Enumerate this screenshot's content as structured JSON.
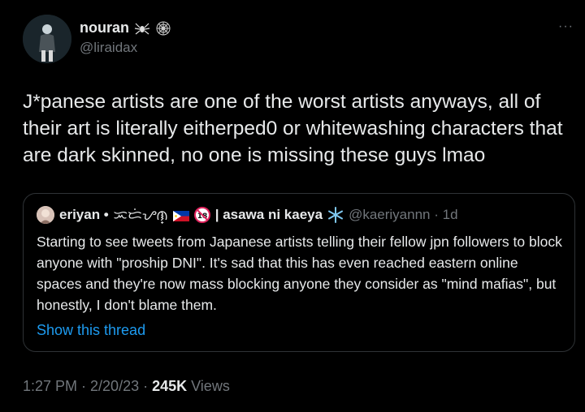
{
  "author": {
    "name": "nouran",
    "handle": "@liraidax",
    "name_icons": [
      "spider-icon",
      "spiderweb-icon"
    ]
  },
  "more_label": "···",
  "tweet": {
    "text": "J*panese artists are one of the worst artists anyways, all of their art is literally eitherped0 or whitewashing characters that are dark skinned, no one is missing these guys lmao"
  },
  "quote": {
    "name": "eriyan •",
    "script_text": "ᜁᜇᜒᜌᜈ᜔",
    "display_extra": "| asawa ni kaeya",
    "handle_time": "@kaeriyannn · 1d",
    "icons": [
      "philippines-flag-icon",
      "18-plus-icon",
      "snowflake-icon"
    ],
    "text": "Starting to see tweets from Japanese artists telling their fellow jpn followers to block anyone with \"proship DNI\". It's sad that this has even reached eastern online spaces and they're now  mass blocking anyone they consider as \"mind mafias\", but honestly, I don't blame them.",
    "show_thread": "Show this thread"
  },
  "meta": {
    "time": "1:27 PM · 2/20/23 · ",
    "views_count": "245K",
    "views_label": " Views"
  },
  "colors": {
    "background": "#000000",
    "text": "#e7e9ea",
    "muted": "#71767b",
    "link": "#1d9bf0",
    "border": "#2f3336"
  }
}
